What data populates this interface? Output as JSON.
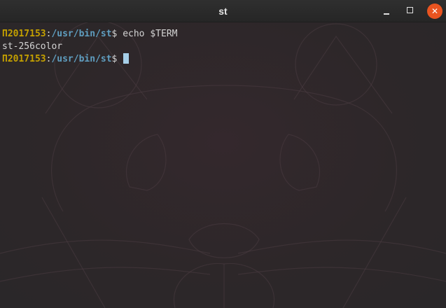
{
  "window": {
    "title": "st",
    "buttons": {
      "minimize": "minimize-icon",
      "maximize": "maximize-icon",
      "close": "close-icon"
    }
  },
  "terminal": {
    "lines": [
      {
        "user": "П2017153",
        "sep": ":",
        "path": "/usr/bin/st",
        "dollar": "$",
        "command": " echo $TERM"
      },
      {
        "output": "st-256color"
      },
      {
        "user": "П2017153",
        "sep": ":",
        "path": "/usr/bin/st",
        "dollar": "$",
        "command": " "
      }
    ]
  },
  "colors": {
    "background": "#2c2a2b",
    "user": "#c4a000",
    "path": "#5f9ec0",
    "text": "#d4d4d4",
    "cursor": "#a6cfe8",
    "close_button": "#e95420"
  }
}
